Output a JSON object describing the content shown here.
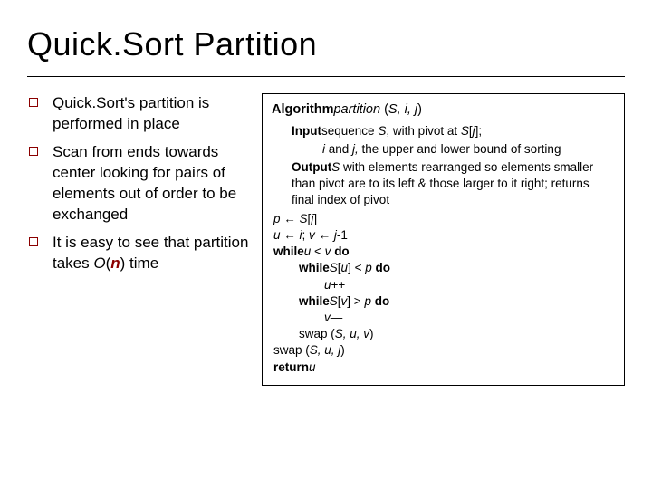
{
  "title": "Quick.Sort Partition",
  "bullets": {
    "b1_a": "Quick.Sort's partition is performed in place",
    "b2_a": "Scan from ends towards center looking for pairs of elements out of order to be exchanged",
    "b3_a": "It is easy to see that partition takes ",
    "b3_b": "O",
    "b3_c": "(",
    "b3_d": "n",
    "b3_e": ") time"
  },
  "algo": {
    "kw_algorithm": "Algorithm",
    "name": "partition",
    "sig_a": " (",
    "sig_b": "S, i, j",
    "sig_c": ")",
    "kw_input": "Input",
    "input_a": "sequence ",
    "input_b": "S",
    "input_c": ", with pivot at ",
    "input_d": "S",
    "input_e": "[",
    "input_f": "j",
    "input_g": "];",
    "input2_a": "i",
    "input2_b": " and ",
    "input2_c": "j, ",
    "input2_d": "the upper and lower bound of sorting",
    "kw_output": "Output",
    "output_a": "S",
    "output_b": " with elements rearranged so elements smaller than pivot are to its left & those larger to it right;   returns final index of pivot",
    "c1_a": "p ",
    "c1_b": "← ",
    "c1_c": "S",
    "c1_d": "[",
    "c1_e": "j",
    "c1_f": "]",
    "c2_a": "u ",
    "c2_b": "← ",
    "c2_c": "i",
    "c2_d": "; ",
    "c2_e": "v ",
    "c2_f": "← ",
    "c2_g": "j",
    "c2_h": "-1",
    "kw_while": "while",
    "c3_a": "u ",
    "c3_b": "< ",
    "c3_c": "v ",
    "kw_do": "do",
    "c4_a": "S",
    "c4_b": "[",
    "c4_c": "u",
    "c4_d": "] < ",
    "c4_e": "p ",
    "c5_a": "u",
    "c5_b": "++",
    "c6_a": "S",
    "c6_b": "[",
    "c6_c": "v",
    "c6_d": "] > ",
    "c6_e": "p ",
    "c7_a": "v",
    "c7_b": "—",
    "c8_a": "swap (",
    "c8_b": "S, u, v",
    "c8_c": ")",
    "c9_a": "swap (",
    "c9_b": "S, u, j",
    "c9_c": ")",
    "kw_return": "return",
    "c10_a": "u"
  }
}
